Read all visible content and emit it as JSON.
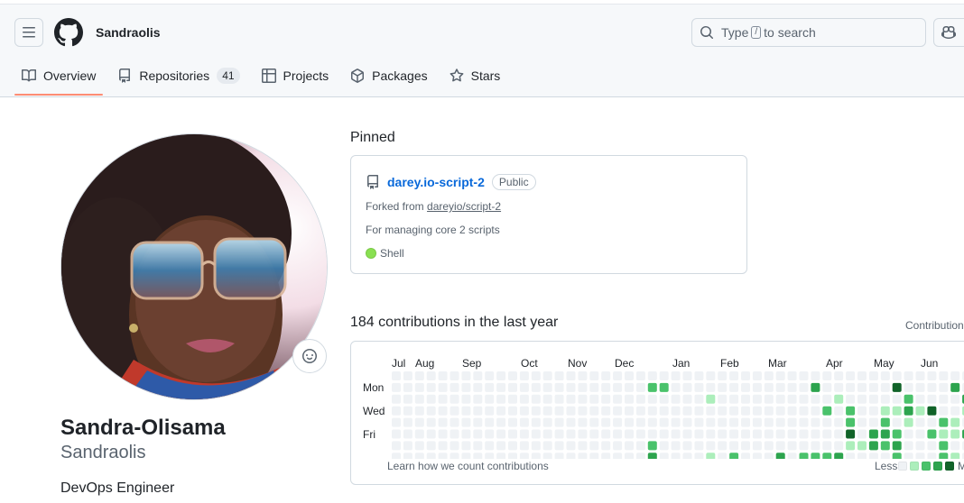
{
  "header": {
    "username": "Sandraolis",
    "search_prefix": "Type",
    "search_key": "/",
    "search_suffix": "to search"
  },
  "tabs": [
    {
      "label": "Overview",
      "icon": "book-icon"
    },
    {
      "label": "Repositories",
      "icon": "repo-icon",
      "count": "41"
    },
    {
      "label": "Projects",
      "icon": "table-icon"
    },
    {
      "label": "Packages",
      "icon": "package-icon"
    },
    {
      "label": "Stars",
      "icon": "star-icon"
    }
  ],
  "profile": {
    "full_name": "Sandra-Olisama",
    "login": "Sandraolis",
    "bio": "DevOps Engineer"
  },
  "pinned": {
    "title": "Pinned",
    "repo_name": "darey.io-script-2",
    "visibility": "Public",
    "forked_prefix": "Forked from",
    "forked_from": "dareyio/script-2",
    "description": "For managing core 2 scripts",
    "language": "Shell",
    "language_color": "#89e051"
  },
  "contributions": {
    "title": "184 contributions in the last year",
    "settings_label": "Contribution",
    "months": [
      "Jul",
      "Aug",
      "Sep",
      "Oct",
      "Nov",
      "Dec",
      "Jan",
      "Feb",
      "Mar",
      "Apr",
      "May",
      "Jun"
    ],
    "day_labels": [
      "Mon",
      "Wed",
      "Fri"
    ],
    "learn_link": "Learn how we count contributions",
    "legend_less": "Less",
    "legend_more": "M",
    "colors": [
      "#eff2f5",
      "#aceebb",
      "#4ac26b",
      "#2da44e",
      "#116329"
    ],
    "grid": [
      "00000000000000000000000000000000000000000000000000",
      "00000000000000000000002200000000000030000004000030",
      "00000000000000000000000000010000000000100000200003",
      "00000000000000000000000000000000000002020011314001",
      "00000000000000000000000000000000000000020020100210",
      "00000000000000000000000000000000000000040332002113",
      "00000000000000000000002000000000000000011323000200",
      "00000000000000000000003000010200030222300002000210"
    ]
  }
}
